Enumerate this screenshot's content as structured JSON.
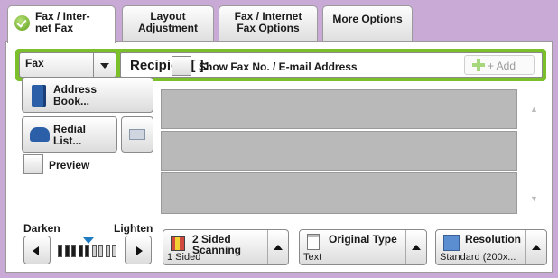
{
  "tabs": [
    {
      "label": "Fax / Inter-\nnet Fax",
      "active": true
    },
    {
      "label": "Layout\nAdjustment",
      "active": false
    },
    {
      "label": "Fax / Internet\nFax Options",
      "active": false
    },
    {
      "label": "More Options",
      "active": false
    }
  ],
  "recipient": {
    "type_value": "Fax",
    "field_label": "Recipient[   ]:",
    "add_label": "+ Add"
  },
  "show_fax_label": "Show Fax No. / E-mail Address",
  "left_buttons": {
    "address_book": "Address\nBook...",
    "redial": "Redial\nList...",
    "preview": "Preview"
  },
  "density": {
    "darken_label": "Darken",
    "lighten_label": "Lighten",
    "level": 0.5
  },
  "features": {
    "two_sided": {
      "title": "2 Sided\nScanning",
      "value": "1 Sided"
    },
    "original_type": {
      "title": "Original Type",
      "value": "Text"
    },
    "resolution": {
      "title": "Resolution",
      "value": "Standard (200x..."
    }
  },
  "colors": {
    "accent_green": "#7bbf2a",
    "frame_purple": "#c9a9d6",
    "slider_blue": "#1f7cc2"
  }
}
